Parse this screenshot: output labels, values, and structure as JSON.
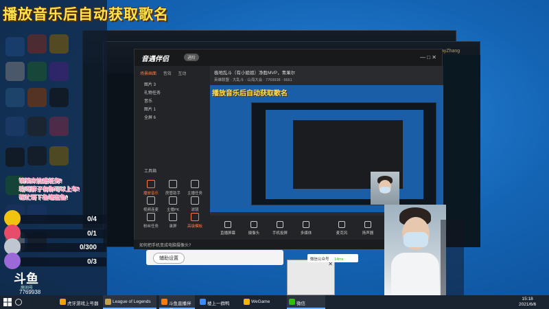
{
  "stream": {
    "title": "播放音乐后自动获取歌名",
    "task_notes": [
      "铛铛来拉感任务!",
      "助呀胖子有你可以上车!",
      "帮忙哥下鱼塘宣鱼!"
    ],
    "tasks": [
      {
        "value": "0/4"
      },
      {
        "value": "0/1"
      },
      {
        "value": "0/300"
      },
      {
        "value": "0/3"
      }
    ],
    "logo": "斗鱼",
    "room_label": "房间号",
    "room_number": "7769938"
  },
  "app": {
    "name": "音遇伴侣",
    "badge": "进阶",
    "side_tabs": [
      "场景画面",
      "音效",
      "互动"
    ],
    "scenes": [
      "图片 3",
      "礼物任务",
      "音乐",
      "图片 1",
      "全屏 6"
    ],
    "tools_label": "工具箱",
    "tools": [
      "播放音乐",
      "房管助手",
      "主播任务",
      "视频连麦",
      "主播PK",
      "滤镜",
      "粉丝任务",
      "录屏",
      "高级模板"
    ],
    "room_title": "极地乱斗（有小姐姐）净胜MVP，青果尔",
    "room_meta": "英雄联盟 · 大乱斗 · 山海大会 · 7769938 · 6661",
    "preview_title": "播放音乐后自动获取歌名",
    "bottom": [
      "直播屏幕",
      "摄像头",
      "手机投屏",
      "多媒体",
      "麦克风",
      "扬声器",
      "录制"
    ],
    "footer_hint": "如何把手机变成电脑摄像头?",
    "settings_label": "辅助设置"
  },
  "wechat": {
    "bar_text": "微信公众号",
    "time": "14ms"
  },
  "lol": {
    "level": "40",
    "username": "LayZhang"
  },
  "taskbar": {
    "items": [
      {
        "label": "虎牙游戏上号器",
        "color": "#f2a300"
      },
      {
        "label": "League of Legends",
        "color": "#c8a04a"
      },
      {
        "label": "斗鱼直播伴侣",
        "color": "#ff7a00"
      },
      {
        "label": "楼上一群鸭",
        "color": "#3a8bff"
      },
      {
        "label": "WeGame",
        "color": "#f5b300"
      },
      {
        "label": "微信",
        "color": "#2dc100"
      }
    ],
    "time": "15:18",
    "date": "2021/6/6"
  },
  "colors": {
    "accent": "#ff7a45",
    "title_yellow": "#ffe54a"
  }
}
